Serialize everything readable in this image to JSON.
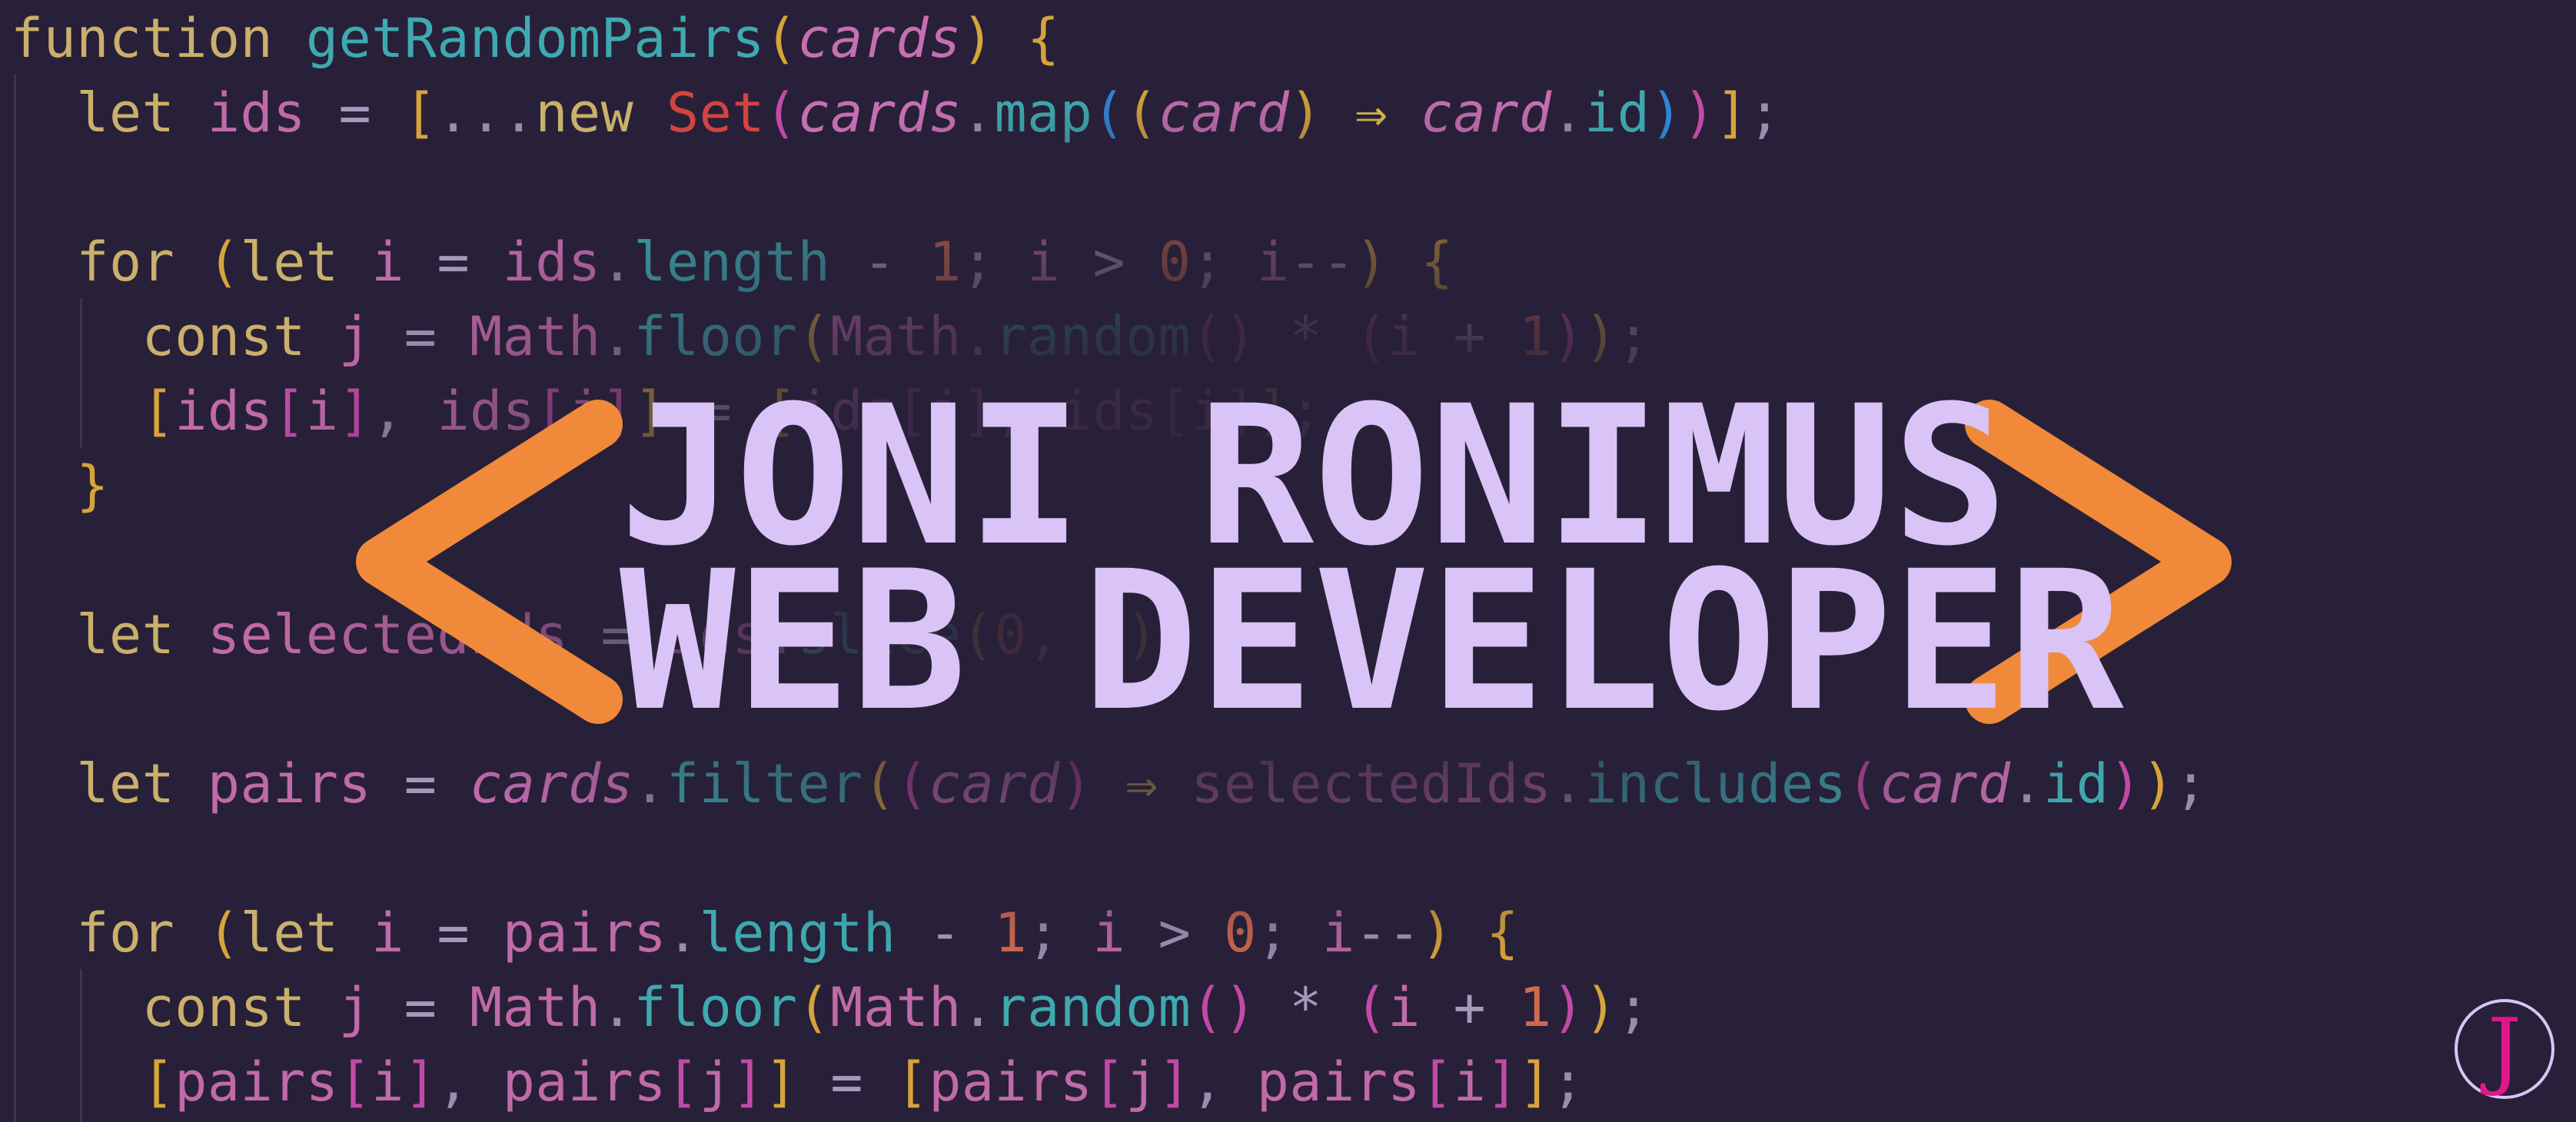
{
  "brand": {
    "name": "JONI RONIMUS",
    "role": "WEB DEVELOPER",
    "monogram": "J",
    "icons": [
      "left-angle-bracket-icon",
      "right-angle-bracket-icon"
    ]
  },
  "colors": {
    "background": "#282038",
    "logo_text": "#d9c3f7",
    "brackets": "#f08a3a",
    "monogram_letter": "#e2168a"
  },
  "code_lines": [
    "function getRandomPairs(cards) {",
    "  let ids = [...new Set(cards.map((card) ⇒ card.id))];",
    "",
    "  for (let i = ids.length - 1; i > 0; i--) {",
    "    const j = Math.floor(Math.random() * (i + 1));",
    "    [ids[i], ids[j]] = [ids[j], ids[i]];",
    "  }",
    "",
    "  let selectedIds = ids.slice(0, 6);",
    "",
    "  let pairs = cards.filter((card) ⇒ selectedIds.includes(card.id));",
    "",
    "  for (let i = pairs.length - 1; i > 0; i--) {",
    "    const j = Math.floor(Math.random() * (i + 1));",
    "    [pairs[i], pairs[j]] = [pairs[j], pairs[i]];"
  ]
}
